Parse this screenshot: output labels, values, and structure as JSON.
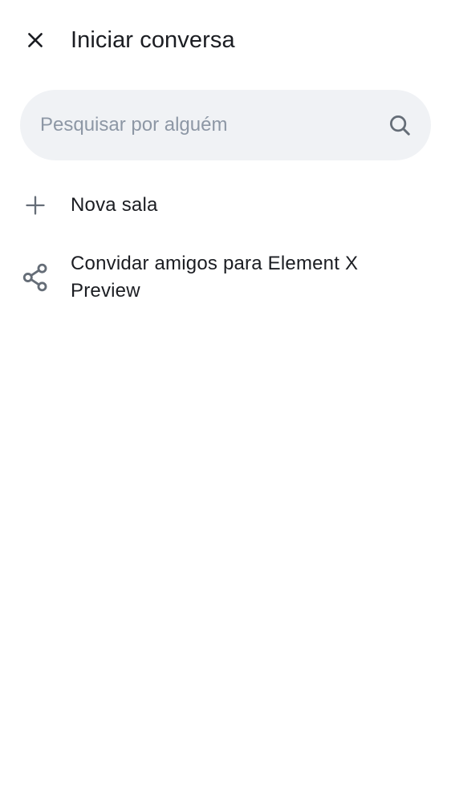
{
  "header": {
    "title": "Iniciar conversa",
    "close_icon": "close-icon"
  },
  "search": {
    "placeholder": "Pesquisar por alguém",
    "value": "",
    "icon": "search-icon"
  },
  "actions": [
    {
      "label": "Nova sala",
      "icon": "plus-icon"
    },
    {
      "label": "Convidar amigos para Element X Preview",
      "icon": "share-icon"
    }
  ],
  "colors": {
    "background": "#ffffff",
    "text_primary": "#1b1d22",
    "icon": "#1b1d22",
    "icon_secondary": "#656d77",
    "search_background": "#f0f2f5",
    "placeholder": "#8d97a5"
  }
}
